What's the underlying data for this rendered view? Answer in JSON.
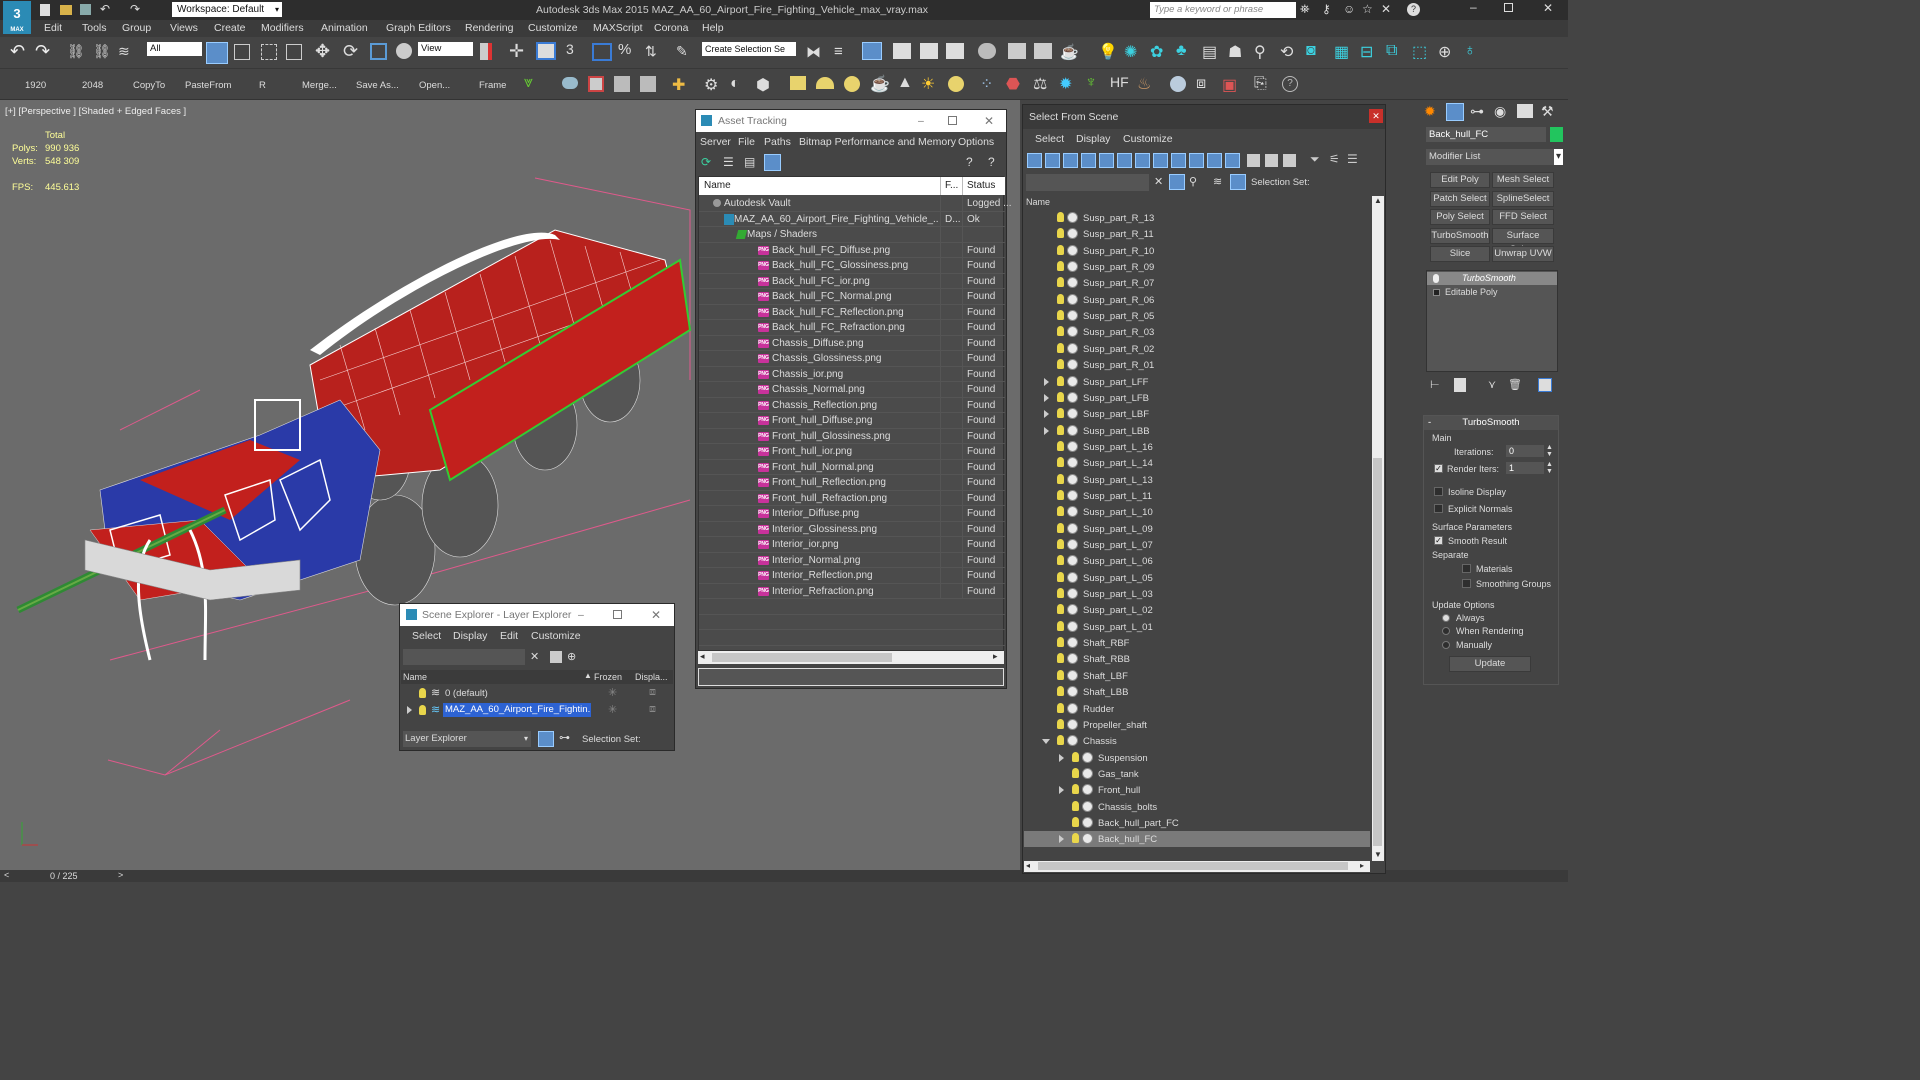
{
  "titlebar": {
    "workspace": "Workspace: Default",
    "app_title": "Autodesk 3ds Max  2015    MAZ_AA_60_Airport_Fire_Fighting_Vehicle_max_vray.max",
    "search_placeholder": "Type a keyword or phrase"
  },
  "menubar": [
    "Edit",
    "Tools",
    "Group",
    "Views",
    "Create",
    "Modifiers",
    "Animation",
    "Graph Editors",
    "Rendering",
    "Customize",
    "MAXScript",
    "Corona",
    "Help"
  ],
  "toolbar1": {
    "filter_all": "All",
    "view": "View",
    "create_selection_set": "Create Selection Se"
  },
  "toolbar2": {
    "labels": [
      "1920",
      "2048",
      "CopyTo",
      "PasteFrom",
      "R",
      "Merge...",
      "Save As...",
      "Open...",
      "Frame"
    ]
  },
  "viewport": {
    "label": "[+] [Perspective ] [Shaded + Edged Faces ]",
    "total": "Total",
    "polys_label": "Polys:",
    "polys": "990 936",
    "verts_label": "Verts:",
    "verts": "548 309",
    "fps_label": "FPS:",
    "fps": "445.613"
  },
  "timeline": {
    "frame": "0 / 225"
  },
  "asset_tracking": {
    "title": "Asset Tracking",
    "menu": [
      "Server",
      "File",
      "Paths",
      "Bitmap Performance and Memory",
      "Options"
    ],
    "col_name": "Name",
    "col_f": "F...",
    "col_status": "Status",
    "rows": [
      {
        "name": "Autodesk Vault",
        "f": "",
        "status": "Logged ..."
      },
      {
        "name": "MAZ_AA_60_Airport_Fire_Fighting_Vehicle_...",
        "f": "D...",
        "status": "Ok"
      },
      {
        "name": "Maps / Shaders",
        "f": "",
        "status": ""
      },
      {
        "name": "Back_hull_FC_Diffuse.png",
        "f": "",
        "status": "Found"
      },
      {
        "name": "Back_hull_FC_Glossiness.png",
        "f": "",
        "status": "Found"
      },
      {
        "name": "Back_hull_FC_ior.png",
        "f": "",
        "status": "Found"
      },
      {
        "name": "Back_hull_FC_Normal.png",
        "f": "",
        "status": "Found"
      },
      {
        "name": "Back_hull_FC_Reflection.png",
        "f": "",
        "status": "Found"
      },
      {
        "name": "Back_hull_FC_Refraction.png",
        "f": "",
        "status": "Found"
      },
      {
        "name": "Chassis_Diffuse.png",
        "f": "",
        "status": "Found"
      },
      {
        "name": "Chassis_Glossiness.png",
        "f": "",
        "status": "Found"
      },
      {
        "name": "Chassis_ior.png",
        "f": "",
        "status": "Found"
      },
      {
        "name": "Chassis_Normal.png",
        "f": "",
        "status": "Found"
      },
      {
        "name": "Chassis_Reflection.png",
        "f": "",
        "status": "Found"
      },
      {
        "name": "Front_hull_Diffuse.png",
        "f": "",
        "status": "Found"
      },
      {
        "name": "Front_hull_Glossiness.png",
        "f": "",
        "status": "Found"
      },
      {
        "name": "Front_hull_ior.png",
        "f": "",
        "status": "Found"
      },
      {
        "name": "Front_hull_Normal.png",
        "f": "",
        "status": "Found"
      },
      {
        "name": "Front_hull_Reflection.png",
        "f": "",
        "status": "Found"
      },
      {
        "name": "Front_hull_Refraction.png",
        "f": "",
        "status": "Found"
      },
      {
        "name": "Interior_Diffuse.png",
        "f": "",
        "status": "Found"
      },
      {
        "name": "Interior_Glossiness.png",
        "f": "",
        "status": "Found"
      },
      {
        "name": "Interior_ior.png",
        "f": "",
        "status": "Found"
      },
      {
        "name": "Interior_Normal.png",
        "f": "",
        "status": "Found"
      },
      {
        "name": "Interior_Reflection.png",
        "f": "",
        "status": "Found"
      },
      {
        "name": "Interior_Refraction.png",
        "f": "",
        "status": "Found"
      }
    ]
  },
  "scene_explorer": {
    "title": "Scene Explorer - Layer Explorer",
    "menu": [
      "Select",
      "Display",
      "Edit",
      "Customize"
    ],
    "col_name": "Name",
    "col_frozen": "Frozen",
    "col_display": "Displa...",
    "rows": [
      "0 (default)",
      "MAZ_AA_60_Airport_Fire_Fightin..."
    ],
    "layer_explorer": "Layer Explorer",
    "selection_set": "Selection Set:"
  },
  "select_from_scene": {
    "title": "Select From Scene",
    "menu": [
      "Select",
      "Display",
      "Customize"
    ],
    "selection_set": "Selection Set:",
    "col_name": "Name",
    "rows": [
      {
        "name": "Susp_part_R_13",
        "indent": 0,
        "expand": false
      },
      {
        "name": "Susp_part_R_11",
        "indent": 0,
        "expand": false
      },
      {
        "name": "Susp_part_R_10",
        "indent": 0,
        "expand": false
      },
      {
        "name": "Susp_part_R_09",
        "indent": 0,
        "expand": false
      },
      {
        "name": "Susp_part_R_07",
        "indent": 0,
        "expand": false
      },
      {
        "name": "Susp_part_R_06",
        "indent": 0,
        "expand": false
      },
      {
        "name": "Susp_part_R_05",
        "indent": 0,
        "expand": false
      },
      {
        "name": "Susp_part_R_03",
        "indent": 0,
        "expand": false
      },
      {
        "name": "Susp_part_R_02",
        "indent": 0,
        "expand": false
      },
      {
        "name": "Susp_part_R_01",
        "indent": 0,
        "expand": false
      },
      {
        "name": "Susp_part_LFF",
        "indent": 0,
        "expand": true
      },
      {
        "name": "Susp_part_LFB",
        "indent": 0,
        "expand": true
      },
      {
        "name": "Susp_part_LBF",
        "indent": 0,
        "expand": true
      },
      {
        "name": "Susp_part_LBB",
        "indent": 0,
        "expand": true
      },
      {
        "name": "Susp_part_L_16",
        "indent": 0,
        "expand": false
      },
      {
        "name": "Susp_part_L_14",
        "indent": 0,
        "expand": false
      },
      {
        "name": "Susp_part_L_13",
        "indent": 0,
        "expand": false
      },
      {
        "name": "Susp_part_L_11",
        "indent": 0,
        "expand": false
      },
      {
        "name": "Susp_part_L_10",
        "indent": 0,
        "expand": false
      },
      {
        "name": "Susp_part_L_09",
        "indent": 0,
        "expand": false
      },
      {
        "name": "Susp_part_L_07",
        "indent": 0,
        "expand": false
      },
      {
        "name": "Susp_part_L_06",
        "indent": 0,
        "expand": false
      },
      {
        "name": "Susp_part_L_05",
        "indent": 0,
        "expand": false
      },
      {
        "name": "Susp_part_L_03",
        "indent": 0,
        "expand": false
      },
      {
        "name": "Susp_part_L_02",
        "indent": 0,
        "expand": false
      },
      {
        "name": "Susp_part_L_01",
        "indent": 0,
        "expand": false
      },
      {
        "name": "Shaft_RBF",
        "indent": 0,
        "expand": false
      },
      {
        "name": "Shaft_RBB",
        "indent": 0,
        "expand": false
      },
      {
        "name": "Shaft_LBF",
        "indent": 0,
        "expand": false
      },
      {
        "name": "Shaft_LBB",
        "indent": 0,
        "expand": false
      },
      {
        "name": "Rudder",
        "indent": 0,
        "expand": false
      },
      {
        "name": "Propeller_shaft",
        "indent": 0,
        "expand": false
      },
      {
        "name": "Chassis",
        "indent": 0,
        "expand": "open"
      },
      {
        "name": "Suspension",
        "indent": 1,
        "expand": true
      },
      {
        "name": "Gas_tank",
        "indent": 1,
        "expand": false
      },
      {
        "name": "Front_hull",
        "indent": 1,
        "expand": true
      },
      {
        "name": "Chassis_bolts",
        "indent": 1,
        "expand": false
      },
      {
        "name": "Back_hull_part_FC",
        "indent": 1,
        "expand": false
      },
      {
        "name": "Back_hull_FC",
        "indent": 1,
        "expand": true,
        "selected": true
      }
    ]
  },
  "command_panel": {
    "object_name": "Back_hull_FC",
    "object_color": "#22c55e",
    "modifier_list": "Modifier List",
    "buttons": [
      "Edit Poly",
      "Mesh Select",
      "Patch Select",
      "SplineSelect",
      "Poly Select",
      "FFD Select",
      "TurboSmooth",
      "Surface Select",
      "Slice",
      "Unwrap UVW"
    ],
    "stack": [
      "TurboSmooth",
      "Editable Poly"
    ],
    "rollout_title": "TurboSmooth",
    "main": "Main",
    "iterations_label": "Iterations:",
    "iterations": "0",
    "render_iters_label": "Render Iters:",
    "render_iters": "1",
    "isoline": "Isoline Display",
    "explicit": "Explicit Normals",
    "surface_params": "Surface Parameters",
    "smooth_result": "Smooth Result",
    "separate": "Separate",
    "materials": "Materials",
    "smoothing_groups": "Smoothing Groups",
    "update_options": "Update Options",
    "always": "Always",
    "when_rendering": "When Rendering",
    "manually": "Manually",
    "update": "Update"
  }
}
